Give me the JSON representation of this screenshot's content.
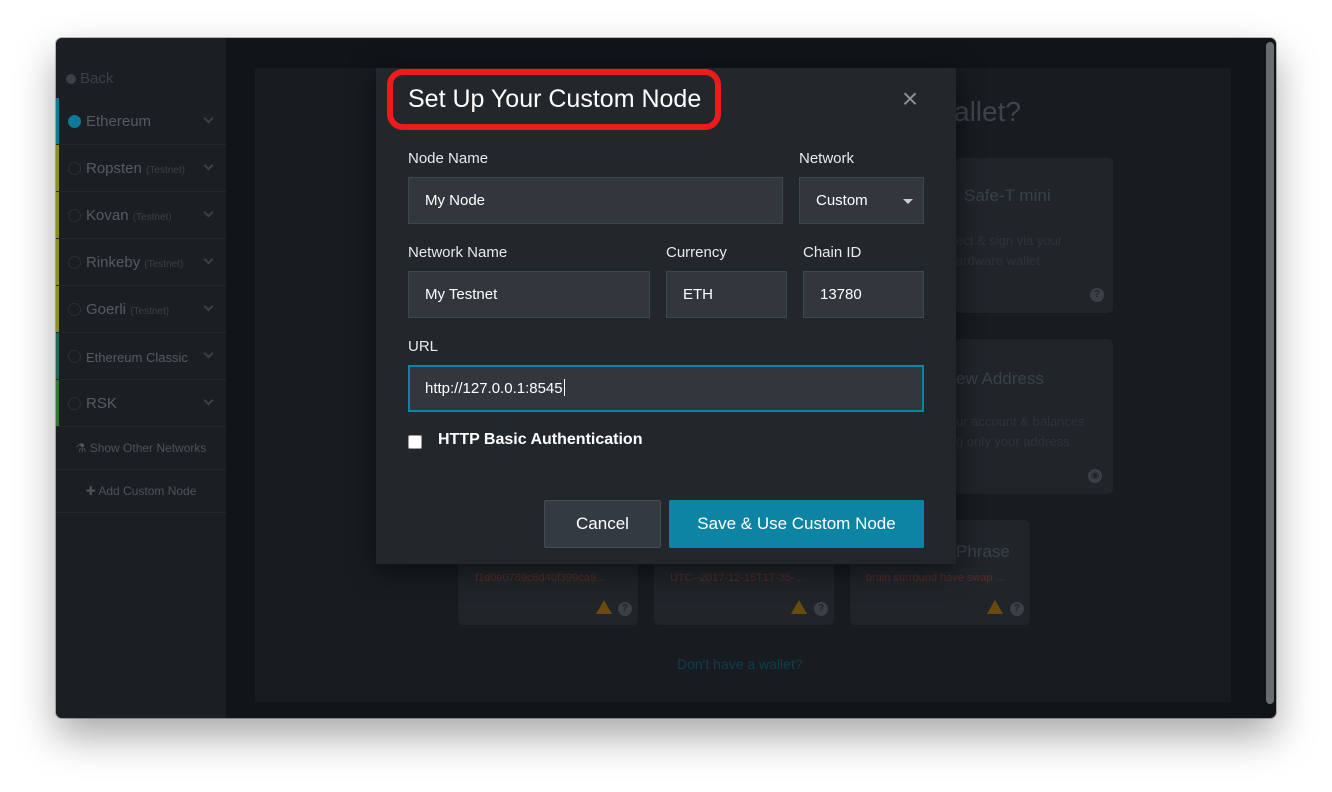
{
  "sidebar": {
    "back_label": "Back",
    "networks": [
      {
        "name": "Ethereum",
        "tag": "",
        "color": "#0e7a99",
        "selected": true
      },
      {
        "name": "Ropsten",
        "tag": "(Testnet)",
        "color": "#8a8f1e",
        "selected": false
      },
      {
        "name": "Kovan",
        "tag": "(Testnet)",
        "color": "#8a8f1e",
        "selected": false
      },
      {
        "name": "Rinkeby",
        "tag": "(Testnet)",
        "color": "#8a8f1e",
        "selected": false
      },
      {
        "name": "Goerli",
        "tag": "(Testnet)",
        "color": "#8a8f1e",
        "selected": false
      },
      {
        "name": "Ethereum Classic",
        "tag": "",
        "color": "#1c6a55",
        "selected": false
      },
      {
        "name": "RSK",
        "tag": "",
        "color": "#2e7a2e",
        "selected": false
      }
    ],
    "show_other_label": "Show Other Networks",
    "add_custom_label": "Add Custom Node"
  },
  "background": {
    "title": "allet?",
    "cards": [
      {
        "title": "Safe-T mini",
        "sub1": "ect & sign via your",
        "sub2": "ardware wallet"
      },
      {
        "title": "ew Address",
        "sub1": "ur account & balances",
        "sub2": "g only your address"
      },
      {
        "title": "Phrase"
      }
    ],
    "row_texts": [
      "f1d0e0789c6d40f399ca9...",
      "UTC--2017-12-15T17-35-...",
      "brain surround have swap ..."
    ],
    "no_wallet_link": "Don't have a wallet?"
  },
  "modal": {
    "title": "Set Up Your Custom Node",
    "node_name_label": "Node Name",
    "node_name_value": "My Node",
    "network_label": "Network",
    "network_value": "Custom",
    "network_name_label": "Network Name",
    "network_name_value": "My Testnet",
    "currency_label": "Currency",
    "currency_value": "ETH",
    "chain_id_label": "Chain ID",
    "chain_id_value": "13780",
    "url_label": "URL",
    "url_value": "http://127.0.0.1:8545",
    "auth_label": "HTTP Basic Authentication",
    "cancel_label": "Cancel",
    "save_label": "Save & Use Custom Node",
    "highlight_color": "#ef1b1b",
    "accent_color": "#0e84a5"
  }
}
